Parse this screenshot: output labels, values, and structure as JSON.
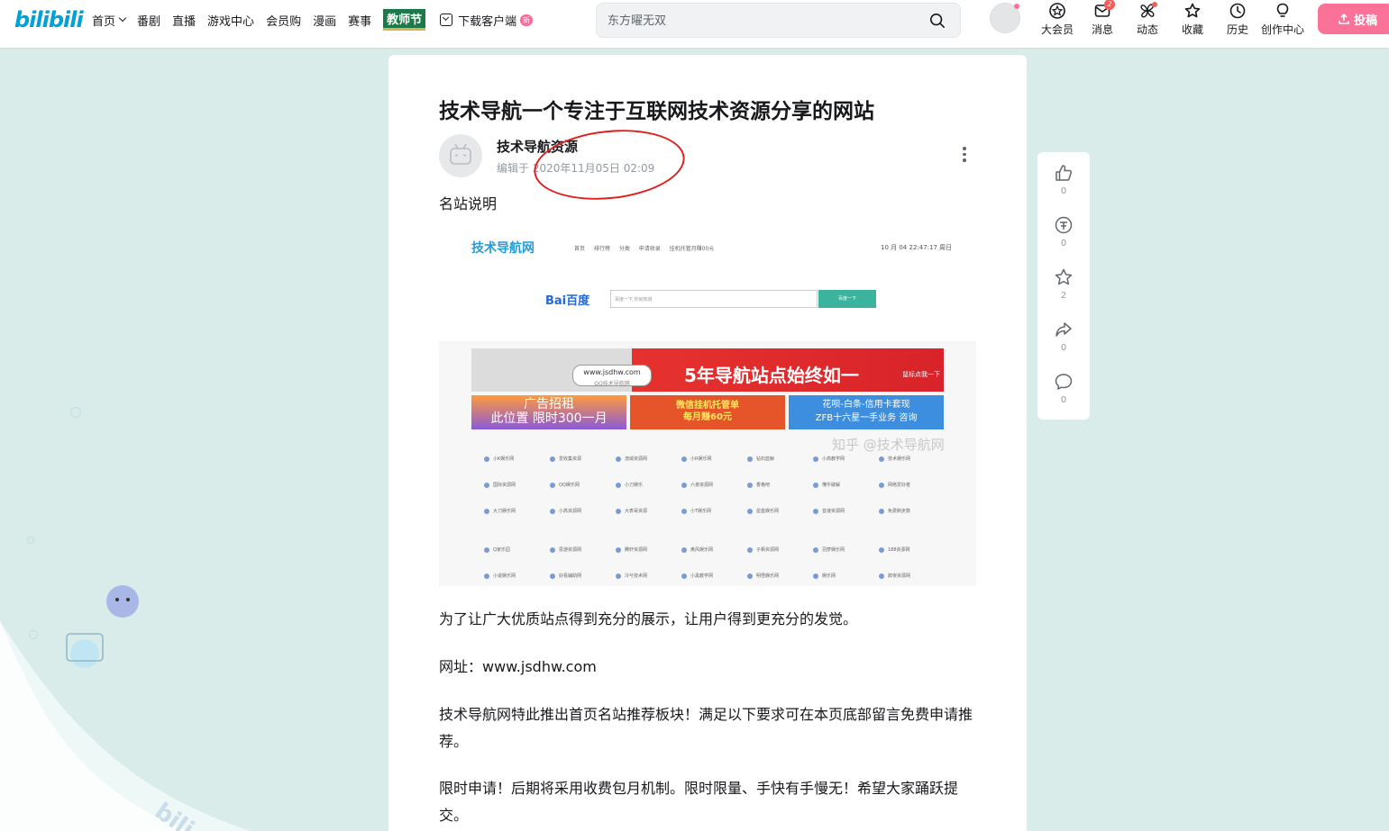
{
  "header": {
    "logo": "bilibili",
    "nav": [
      {
        "label": "首页",
        "has_dropdown": true
      },
      {
        "label": "番剧"
      },
      {
        "label": "直播"
      },
      {
        "label": "游戏中心"
      },
      {
        "label": "会员购"
      },
      {
        "label": "漫画"
      },
      {
        "label": "赛事"
      }
    ],
    "teacher_festival": "教师节",
    "download_label": "下载客户端",
    "new_badge": "新",
    "search_placeholder": "东方曜无双",
    "right_icons": [
      {
        "label": "大会员",
        "icon": "vip-icon"
      },
      {
        "label": "消息",
        "icon": "message-icon",
        "badge": "2"
      },
      {
        "label": "动态",
        "icon": "dynamic-icon",
        "dot": true
      },
      {
        "label": "收藏",
        "icon": "favorite-icon"
      },
      {
        "label": "历史",
        "icon": "history-icon"
      },
      {
        "label": "创作中心",
        "icon": "creator-icon"
      }
    ],
    "upload_label": "投稿"
  },
  "article": {
    "title": "技术导航一个专注于互联网技术资源分享的网站",
    "author": "技术导航资源",
    "edit_prefix": "编辑于",
    "edit_time": "2020年11月05日 02:09",
    "subhead": "名站说明",
    "paragraphs": [
      "为了让广大优质站点得到充分的展示，让用户得到更充分的发觉。",
      "网址：www.jsdhw.com",
      "技术导航网特此推出首页名站推荐板块！满足以下要求可在本页底部留言免费申请推荐。",
      "限时申请！后期将采用收费包月机制。限时限量、手快有手慢无！希望大家踊跃提交。"
    ]
  },
  "embedded_image": {
    "logo": "技术导航网",
    "nav": "首页 排行榜 分类 申请收录 挂机托管月赚00元",
    "date": "10 月 04 22:47:17 周日",
    "baidu": "Bai百度",
    "search_hint": "百度一下,你就知道",
    "search_button": "百度一下",
    "banner_url": "www.jsdhw.com",
    "banner_url_sub": "QQ技术导航网",
    "banner_main": "5年导航站点始终如一",
    "banner_small": "鼠标点我一下",
    "ad1_line1": "广告招租",
    "ad1_line2": "此位置 限时300一月",
    "ad2_line1": "微信挂机托管单",
    "ad2_line2": "每月赚60元",
    "ad3_line1": "花呗-白条-信用卡套现",
    "ad3_line2": "ZFB十六星一手业务 咨询",
    "grid_rows": [
      [
        "小K娱乐网",
        "爱收集资源",
        "流域资源网",
        "小R娱乐网",
        "钻石蓝鲸",
        "小高教学网",
        "技术娱乐网"
      ],
      [
        "国际资源网",
        "QQ娱乐网",
        "小刀娱乐",
        "六弟资源网",
        "香格吧",
        "懂牛破解",
        "网络爱好者"
      ],
      [
        "大刀娱乐网",
        "小高资源网",
        "大表哥资源",
        "小T娱乐网",
        "星座娱乐网",
        "音速资源网",
        "免费刷步数"
      ],
      [
        "Q家乐园",
        "思游资源网",
        "腾轩资源网",
        "奥风娱乐网",
        "子枫资源网",
        "羽梦娱乐网",
        "188资源网"
      ],
      [
        "小说娱乐网",
        "好看辅助网",
        "冷兮技术网",
        "小黑教学网",
        "明悟娱乐网",
        "娱乐网",
        "辞夜资源网"
      ]
    ],
    "watermark": "知乎 @技术导航网"
  },
  "side_toolbar": [
    {
      "icon": "like-icon",
      "count": "0"
    },
    {
      "icon": "coin-icon",
      "count": "0"
    },
    {
      "icon": "star-icon",
      "count": "2"
    },
    {
      "icon": "share-icon",
      "count": "0"
    },
    {
      "icon": "comment-icon",
      "count": "0"
    }
  ],
  "colors": {
    "brand": "#00a1d6",
    "pink": "#fb7299",
    "annotation": "#e02020",
    "background": "#d9ecea"
  }
}
